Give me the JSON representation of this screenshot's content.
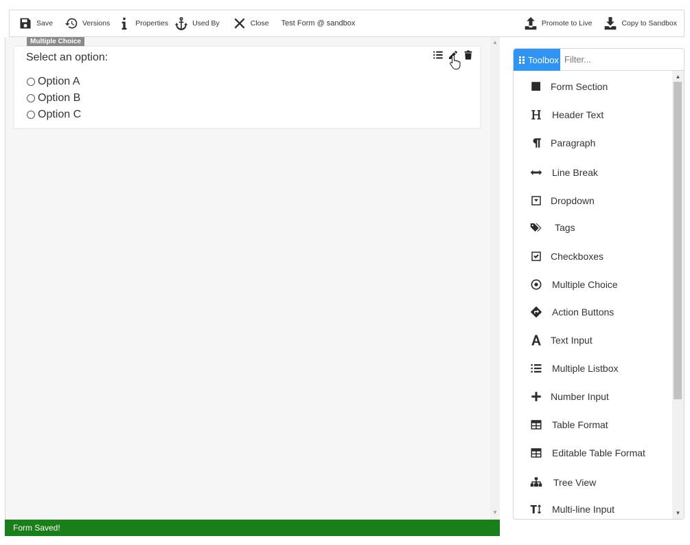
{
  "toolbar": {
    "save": "Save",
    "versions": "Versions",
    "properties": "Properties",
    "used_by": "Used By",
    "close": "Close",
    "form_title": "Test Form @ sandbox",
    "promote": "Promote to Live",
    "copy_sandbox": "Copy to Sandbox"
  },
  "canvas": {
    "control_tag": "Multiple Choice",
    "question": "Select an option:",
    "options": [
      "Option A",
      "Option B",
      "Option C"
    ]
  },
  "status": {
    "message": "Form Saved!",
    "color": "#1a7f18"
  },
  "toolbox": {
    "tab_label": "Toolbox",
    "filter_placeholder": "Filter...",
    "accent": "#2f95f5",
    "items": [
      {
        "label": "Form Section",
        "icon": "square-icon"
      },
      {
        "label": "Header Text",
        "icon": "heading-icon"
      },
      {
        "label": "Paragraph",
        "icon": "paragraph-icon"
      },
      {
        "label": "Line Break",
        "icon": "arrows-h-icon"
      },
      {
        "label": "Dropdown",
        "icon": "caret-square-down-icon"
      },
      {
        "label": "Tags",
        "icon": "tags-icon"
      },
      {
        "label": "Checkboxes",
        "icon": "check-square-icon"
      },
      {
        "label": "Multiple Choice",
        "icon": "dot-circle-icon"
      },
      {
        "label": "Action Buttons",
        "icon": "directions-icon"
      },
      {
        "label": "Text Input",
        "icon": "font-icon"
      },
      {
        "label": "Multiple Listbox",
        "icon": "list-icon"
      },
      {
        "label": "Number Input",
        "icon": "plus-icon"
      },
      {
        "label": "Table Format",
        "icon": "table-icon"
      },
      {
        "label": "Editable Table Format",
        "icon": "table-icon"
      },
      {
        "label": "Tree View",
        "icon": "sitemap-icon"
      },
      {
        "label": "Multi-line Input",
        "icon": "text-height-icon"
      }
    ]
  }
}
